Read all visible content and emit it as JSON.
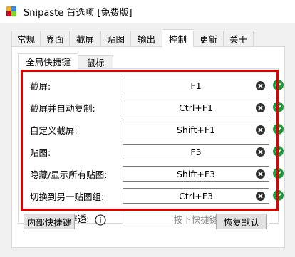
{
  "window": {
    "title": "Snipaste 首选项 [免费版]"
  },
  "tabs": [
    {
      "label": "常规"
    },
    {
      "label": "界面"
    },
    {
      "label": "截屏"
    },
    {
      "label": "贴图"
    },
    {
      "label": "输出"
    },
    {
      "label": "控制",
      "active": true
    },
    {
      "label": "更新"
    },
    {
      "label": "关于"
    }
  ],
  "subtabs": [
    {
      "label": "全局快捷键",
      "active": true
    },
    {
      "label": "鼠标"
    }
  ],
  "shortcuts": [
    {
      "label": "截屏:",
      "key": "F1"
    },
    {
      "label": "截屏并自动复制:",
      "key": "Ctrl+F1"
    },
    {
      "label": "自定义截屏:",
      "key": "Shift+F1"
    },
    {
      "label": "贴图:",
      "key": "F3"
    },
    {
      "label": "隐藏/显示所有贴图:",
      "key": "Shift+F3"
    },
    {
      "label": "切换到另一贴图组:",
      "key": "Ctrl+F3"
    }
  ],
  "mouse_passthrough": {
    "label": "开/关鼠标穿透:",
    "placeholder": "按下快捷键"
  },
  "buttons": {
    "internal": "内部快捷键",
    "restore": "恢复默认"
  },
  "colors": {
    "accent_ok": "#1f9a3b",
    "highlight": "#e00000",
    "clear": "#333333"
  },
  "icons": {
    "app": "snipaste-logo-icon",
    "clear": "clear-icon",
    "ok": "check-ok-icon",
    "info": "info-icon"
  }
}
